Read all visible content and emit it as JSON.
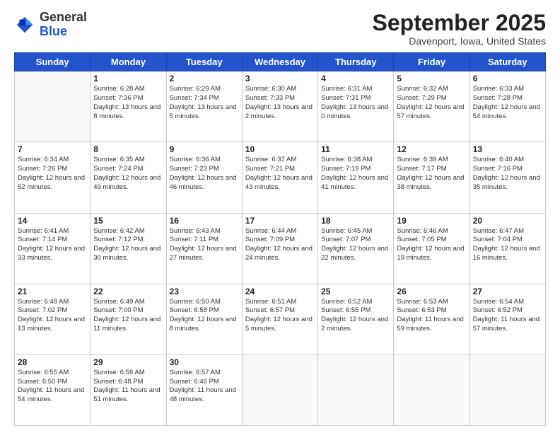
{
  "header": {
    "logo_line1": "General",
    "logo_line2": "Blue",
    "month_title": "September 2025",
    "location": "Davenport, Iowa, United States"
  },
  "days_of_week": [
    "Sunday",
    "Monday",
    "Tuesday",
    "Wednesday",
    "Thursday",
    "Friday",
    "Saturday"
  ],
  "weeks": [
    [
      {
        "day": "",
        "sunrise": "",
        "sunset": "",
        "daylight": ""
      },
      {
        "day": "1",
        "sunrise": "Sunrise: 6:28 AM",
        "sunset": "Sunset: 7:36 PM",
        "daylight": "Daylight: 13 hours and 8 minutes."
      },
      {
        "day": "2",
        "sunrise": "Sunrise: 6:29 AM",
        "sunset": "Sunset: 7:34 PM",
        "daylight": "Daylight: 13 hours and 5 minutes."
      },
      {
        "day": "3",
        "sunrise": "Sunrise: 6:30 AM",
        "sunset": "Sunset: 7:33 PM",
        "daylight": "Daylight: 13 hours and 2 minutes."
      },
      {
        "day": "4",
        "sunrise": "Sunrise: 6:31 AM",
        "sunset": "Sunset: 7:31 PM",
        "daylight": "Daylight: 13 hours and 0 minutes."
      },
      {
        "day": "5",
        "sunrise": "Sunrise: 6:32 AM",
        "sunset": "Sunset: 7:29 PM",
        "daylight": "Daylight: 12 hours and 57 minutes."
      },
      {
        "day": "6",
        "sunrise": "Sunrise: 6:33 AM",
        "sunset": "Sunset: 7:28 PM",
        "daylight": "Daylight: 12 hours and 54 minutes."
      }
    ],
    [
      {
        "day": "7",
        "sunrise": "Sunrise: 6:34 AM",
        "sunset": "Sunset: 7:26 PM",
        "daylight": "Daylight: 12 hours and 52 minutes."
      },
      {
        "day": "8",
        "sunrise": "Sunrise: 6:35 AM",
        "sunset": "Sunset: 7:24 PM",
        "daylight": "Daylight: 12 hours and 49 minutes."
      },
      {
        "day": "9",
        "sunrise": "Sunrise: 6:36 AM",
        "sunset": "Sunset: 7:23 PM",
        "daylight": "Daylight: 12 hours and 46 minutes."
      },
      {
        "day": "10",
        "sunrise": "Sunrise: 6:37 AM",
        "sunset": "Sunset: 7:21 PM",
        "daylight": "Daylight: 12 hours and 43 minutes."
      },
      {
        "day": "11",
        "sunrise": "Sunrise: 6:38 AM",
        "sunset": "Sunset: 7:19 PM",
        "daylight": "Daylight: 12 hours and 41 minutes."
      },
      {
        "day": "12",
        "sunrise": "Sunrise: 6:39 AM",
        "sunset": "Sunset: 7:17 PM",
        "daylight": "Daylight: 12 hours and 38 minutes."
      },
      {
        "day": "13",
        "sunrise": "Sunrise: 6:40 AM",
        "sunset": "Sunset: 7:16 PM",
        "daylight": "Daylight: 12 hours and 35 minutes."
      }
    ],
    [
      {
        "day": "14",
        "sunrise": "Sunrise: 6:41 AM",
        "sunset": "Sunset: 7:14 PM",
        "daylight": "Daylight: 12 hours and 33 minutes."
      },
      {
        "day": "15",
        "sunrise": "Sunrise: 6:42 AM",
        "sunset": "Sunset: 7:12 PM",
        "daylight": "Daylight: 12 hours and 30 minutes."
      },
      {
        "day": "16",
        "sunrise": "Sunrise: 6:43 AM",
        "sunset": "Sunset: 7:11 PM",
        "daylight": "Daylight: 12 hours and 27 minutes."
      },
      {
        "day": "17",
        "sunrise": "Sunrise: 6:44 AM",
        "sunset": "Sunset: 7:09 PM",
        "daylight": "Daylight: 12 hours and 24 minutes."
      },
      {
        "day": "18",
        "sunrise": "Sunrise: 6:45 AM",
        "sunset": "Sunset: 7:07 PM",
        "daylight": "Daylight: 12 hours and 22 minutes."
      },
      {
        "day": "19",
        "sunrise": "Sunrise: 6:46 AM",
        "sunset": "Sunset: 7:05 PM",
        "daylight": "Daylight: 12 hours and 19 minutes."
      },
      {
        "day": "20",
        "sunrise": "Sunrise: 6:47 AM",
        "sunset": "Sunset: 7:04 PM",
        "daylight": "Daylight: 12 hours and 16 minutes."
      }
    ],
    [
      {
        "day": "21",
        "sunrise": "Sunrise: 6:48 AM",
        "sunset": "Sunset: 7:02 PM",
        "daylight": "Daylight: 12 hours and 13 minutes."
      },
      {
        "day": "22",
        "sunrise": "Sunrise: 6:49 AM",
        "sunset": "Sunset: 7:00 PM",
        "daylight": "Daylight: 12 hours and 11 minutes."
      },
      {
        "day": "23",
        "sunrise": "Sunrise: 6:50 AM",
        "sunset": "Sunset: 6:58 PM",
        "daylight": "Daylight: 12 hours and 8 minutes."
      },
      {
        "day": "24",
        "sunrise": "Sunrise: 6:51 AM",
        "sunset": "Sunset: 6:57 PM",
        "daylight": "Daylight: 12 hours and 5 minutes."
      },
      {
        "day": "25",
        "sunrise": "Sunrise: 6:52 AM",
        "sunset": "Sunset: 6:55 PM",
        "daylight": "Daylight: 12 hours and 2 minutes."
      },
      {
        "day": "26",
        "sunrise": "Sunrise: 6:53 AM",
        "sunset": "Sunset: 6:53 PM",
        "daylight": "Daylight: 11 hours and 59 minutes."
      },
      {
        "day": "27",
        "sunrise": "Sunrise: 6:54 AM",
        "sunset": "Sunset: 6:52 PM",
        "daylight": "Daylight: 11 hours and 57 minutes."
      }
    ],
    [
      {
        "day": "28",
        "sunrise": "Sunrise: 6:55 AM",
        "sunset": "Sunset: 6:50 PM",
        "daylight": "Daylight: 11 hours and 54 minutes."
      },
      {
        "day": "29",
        "sunrise": "Sunrise: 6:56 AM",
        "sunset": "Sunset: 6:48 PM",
        "daylight": "Daylight: 11 hours and 51 minutes."
      },
      {
        "day": "30",
        "sunrise": "Sunrise: 6:57 AM",
        "sunset": "Sunset: 6:46 PM",
        "daylight": "Daylight: 11 hours and 48 minutes."
      },
      {
        "day": "",
        "sunrise": "",
        "sunset": "",
        "daylight": ""
      },
      {
        "day": "",
        "sunrise": "",
        "sunset": "",
        "daylight": ""
      },
      {
        "day": "",
        "sunrise": "",
        "sunset": "",
        "daylight": ""
      },
      {
        "day": "",
        "sunrise": "",
        "sunset": "",
        "daylight": ""
      }
    ]
  ]
}
